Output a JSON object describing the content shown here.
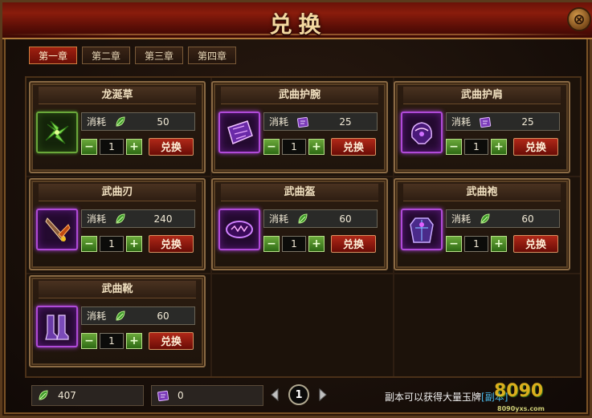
{
  "window": {
    "title": "兑换",
    "close_label": "⊗"
  },
  "tabs": [
    {
      "label": "第一章",
      "active": true
    },
    {
      "label": "第二章",
      "active": false
    },
    {
      "label": "第三章",
      "active": false
    },
    {
      "label": "第四章",
      "active": false
    }
  ],
  "common": {
    "cost_label": "消耗",
    "exchange_label": "兑换",
    "minus": "−",
    "plus": "+"
  },
  "items": [
    {
      "name": "龙涎草",
      "cost": "50",
      "currency": "jade-leaf-icon",
      "qty": "1",
      "icon": "herb-icon"
    },
    {
      "name": "武曲护腕",
      "cost": "25",
      "currency": "purple-token-icon",
      "qty": "1",
      "icon": "bracer-icon"
    },
    {
      "name": "武曲护肩",
      "cost": "25",
      "currency": "purple-token-icon",
      "qty": "1",
      "icon": "pauldron-icon"
    },
    {
      "name": "武曲刃",
      "cost": "240",
      "currency": "jade-leaf-icon",
      "qty": "1",
      "icon": "blade-icon"
    },
    {
      "name": "武曲盔",
      "cost": "60",
      "currency": "jade-leaf-icon",
      "qty": "1",
      "icon": "helmet-icon"
    },
    {
      "name": "武曲袍",
      "cost": "60",
      "currency": "jade-leaf-icon",
      "qty": "1",
      "icon": "robe-icon"
    },
    {
      "name": "武曲靴",
      "cost": "60",
      "currency": "jade-leaf-icon",
      "qty": "1",
      "icon": "boots-icon"
    }
  ],
  "footer": {
    "jade_balance": "407",
    "token_balance": "0",
    "page": "1",
    "hint_text": "副本可以获得大量玉牌",
    "hint_link": "[副本]"
  },
  "watermark": {
    "text": "8090",
    "sub": "8090yxs.com"
  },
  "colors": {
    "accent_red": "#a02010",
    "epic_purple": "#b04ad8",
    "jade_green": "#6aa83a",
    "link_blue": "#4ab8e8"
  }
}
